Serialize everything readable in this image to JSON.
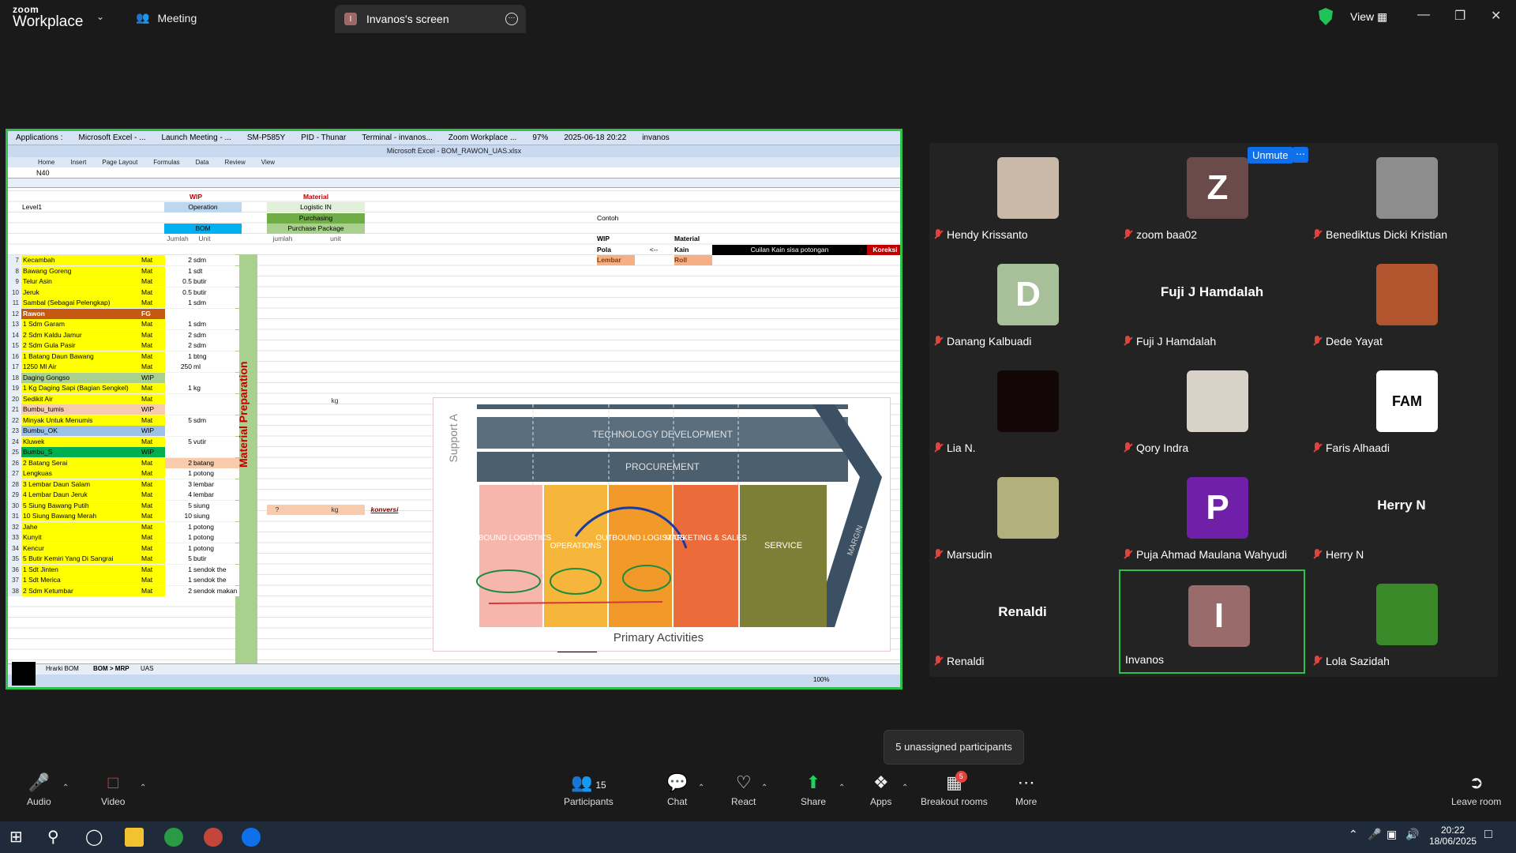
{
  "titlebar": {
    "logo_top": "zoom",
    "logo_bottom": "Workplace",
    "meeting_label": "Meeting",
    "tab_initial": "I",
    "tab_title": "Invanos's screen",
    "view_label": "View"
  },
  "shared_screen": {
    "taskbar_items": [
      "Applications :",
      "Microsoft Excel - ...",
      "Launch Meeting - ...",
      "SM-P585Y",
      "PID - Thunar",
      "Terminal - invanos...",
      "Zoom Workplace ...",
      "97%",
      "2025-06-18 20:22",
      "invanos"
    ],
    "excel_title": "Microsoft Excel - BOM_RAWON_UAS.xlsx",
    "ribbon_tabs": [
      "Home",
      "Insert",
      "Page Layout",
      "Formulas",
      "Data",
      "Review",
      "View"
    ],
    "name_box": "N40",
    "headers": {
      "wip": "WIP",
      "material": "Material",
      "level1": "Level1",
      "operation": "Operation",
      "logistic_in": "Logistic IN",
      "purchasing": "Purchasing",
      "bom": "BOM",
      "purchase_package": "Purchase Package",
      "jumlah": "Jumlah",
      "unit": "Unit",
      "jumlah2": "jumlah",
      "unit2": "unit",
      "contoh": "Contoh",
      "wip2": "WIP",
      "material2": "Material",
      "pola": "Pola",
      "arrow": "<--",
      "kain": "Kain",
      "cuilan": "Cuilan Kain sisa potongan",
      "koreksi": "Koreksi",
      "lembar": "Lembar",
      "roll": "Roll",
      "material_prep": "Material Preparation"
    },
    "rows": [
      {
        "n": "7",
        "b": "Kecambah",
        "c": "Mat",
        "d": "2",
        "e": "sdm"
      },
      {
        "n": "8",
        "b": "Bawang Goreng",
        "c": "Mat",
        "d": "1",
        "e": "sdt"
      },
      {
        "n": "9",
        "b": "Telur Asin",
        "c": "Mat",
        "d": "0.5",
        "e": "butir"
      },
      {
        "n": "10",
        "b": "Jeruk",
        "c": "Mat",
        "d": "0.5",
        "e": "butir"
      },
      {
        "n": "11",
        "b": "Sambal (Sebagai Pelengkap)",
        "c": "Mat",
        "d": "1",
        "e": "sdm"
      },
      {
        "n": "12",
        "b": "Rawon",
        "c": "FG",
        "d": "",
        "e": ""
      },
      {
        "n": "13",
        "b": "1 Sdm Garam",
        "c": "Mat",
        "d": "1",
        "e": "sdm"
      },
      {
        "n": "14",
        "b": "2 Sdm Kaldu Jamur",
        "c": "Mat",
        "d": "2",
        "e": "sdm"
      },
      {
        "n": "15",
        "b": "2 Sdm Gula Pasir",
        "c": "Mat",
        "d": "2",
        "e": "sdm"
      },
      {
        "n": "16",
        "b": "1 Batang Daun Bawang",
        "c": "Mat",
        "d": "1",
        "e": "btng"
      },
      {
        "n": "17",
        "b": "1250 Ml Air",
        "c": "Mat",
        "d": "250",
        "e": "ml"
      },
      {
        "n": "18",
        "b": "Daging Gongso",
        "c": "WIP",
        "d": "",
        "e": ""
      },
      {
        "n": "19",
        "b": "1 Kg Daging Sapi (Bagian Sengkel)",
        "c": "Mat",
        "d": "1",
        "e": "kg"
      },
      {
        "n": "20",
        "b": "Sedikit Air",
        "c": "Mat",
        "d": "",
        "e": ""
      },
      {
        "n": "21",
        "b": "Bumbu_tumis",
        "c": "WIP",
        "d": "",
        "e": ""
      },
      {
        "n": "22",
        "b": "Minyak Untuk Menumis",
        "c": "Mat",
        "d": "5",
        "e": "sdm"
      },
      {
        "n": "23",
        "b": "Bumbu_OK",
        "c": "WIP",
        "d": "",
        "e": ""
      },
      {
        "n": "24",
        "b": "Kluwek",
        "c": "Mat",
        "d": "5",
        "e": "vutir"
      },
      {
        "n": "25",
        "b": "Bumbu_S",
        "c": "WIP",
        "d": "",
        "e": ""
      },
      {
        "n": "26",
        "b": "2 Batang Serai",
        "c": "Mat",
        "d": "2",
        "e": "batang"
      },
      {
        "n": "27",
        "b": "Lengkuas",
        "c": "Mat",
        "d": "1",
        "e": "potong"
      },
      {
        "n": "28",
        "b": "3 Lembar Daun Salam",
        "c": "Mat",
        "d": "3",
        "e": "lembar"
      },
      {
        "n": "29",
        "b": "4 Lembar Daun Jeruk",
        "c": "Mat",
        "d": "4",
        "e": "lembar"
      },
      {
        "n": "30",
        "b": "5 Siung Bawang Putih",
        "c": "Mat",
        "d": "5",
        "e": "siung"
      },
      {
        "n": "31",
        "b": "10 Siung Bawang Merah",
        "c": "Mat",
        "d": "10",
        "e": "siung"
      },
      {
        "n": "32",
        "b": "Jahe",
        "c": "Mat",
        "d": "1",
        "e": "potong"
      },
      {
        "n": "33",
        "b": "Kunyit",
        "c": "Mat",
        "d": "1",
        "e": "potong"
      },
      {
        "n": "34",
        "b": "Kencur",
        "c": "Mat",
        "d": "1",
        "e": "potong"
      },
      {
        "n": "35",
        "b": "5 Butir Kemiri Yang Di Sangrai",
        "c": "Mat",
        "d": "5",
        "e": "butir"
      },
      {
        "n": "36",
        "b": "1 Sdt Jinten",
        "c": "Mat",
        "d": "1",
        "e": "sendok the"
      },
      {
        "n": "37",
        "b": "1 Sdt Merica",
        "c": "Mat",
        "d": "1",
        "e": "sendok the"
      },
      {
        "n": "38",
        "b": "2 Sdm Ketumbar",
        "c": "Mat",
        "d": "2",
        "e": "sendok makan"
      }
    ],
    "extra_cells": {
      "kg19": "kg",
      "q26": "?",
      "kg26": "kg",
      "konversi": "konversi"
    },
    "value_chain": {
      "support": "Support A",
      "tech": "TECHNOLOGY DEVELOPMENT",
      "proc": "PROCUREMENT",
      "margin": "MARGIN",
      "inbound": "INBOUND LOGISTICS",
      "operations": "OPERATIONS",
      "outbound": "OUTBOUND LOGISTICS",
      "marketing": "MARKETING & SALES",
      "service": "SERVICE",
      "primary": "Primary Activities"
    },
    "sheet_tabs": [
      "Hrarki BOM",
      "BOM > MRP",
      "UAS"
    ],
    "zoom": "100%"
  },
  "participants_panel": {
    "unmute_label": "Unmute",
    "tiles": [
      {
        "name": "Hendy Krissanto",
        "type": "photo",
        "color": "#c9b9a8"
      },
      {
        "name": "zoom baa02",
        "type": "letter",
        "letter": "Z",
        "color": "#6b4a4a"
      },
      {
        "name": "Benediktus Dicki Kristian",
        "type": "photo",
        "color": "#8d8d8d"
      },
      {
        "name": "Danang Kalbuadi",
        "type": "letter",
        "letter": "D",
        "color": "#a8c09a"
      },
      {
        "name": "Fuji J Hamdalah",
        "type": "name",
        "big": "Fuji J Hamdalah"
      },
      {
        "name": "Dede Yayat",
        "type": "photo",
        "color": "#b2552f"
      },
      {
        "name": "Lia N.",
        "type": "photo",
        "color": "#120606"
      },
      {
        "name": "Qory Indra",
        "type": "photo",
        "color": "#d8d2c8"
      },
      {
        "name": "Faris Alhaadi",
        "type": "photo",
        "color": "#ffffff",
        "logo": "FAM"
      },
      {
        "name": "Marsudin",
        "type": "photo",
        "color": "#b2b07d"
      },
      {
        "name": "Puja Ahmad Maulana Wahyudi",
        "type": "letter",
        "letter": "P",
        "color": "#6f1fa8"
      },
      {
        "name": "Herry N",
        "type": "name",
        "big": "Herry N"
      },
      {
        "name": "Renaldi",
        "type": "name",
        "big": "Renaldi"
      },
      {
        "name": "Invanos",
        "type": "letter",
        "letter": "I",
        "color": "#9a6b6b",
        "active": true
      },
      {
        "name": "Lola Sazidah",
        "type": "photo",
        "color": "#3a8a2a"
      }
    ]
  },
  "tooltip": "5 unassigned participants",
  "toolbar": {
    "audio": "Audio",
    "video": "Video",
    "participants": "Participants",
    "participants_count": "15",
    "chat": "Chat",
    "react": "React",
    "share": "Share",
    "apps": "Apps",
    "breakout": "Breakout rooms",
    "breakout_badge": "5",
    "more": "More",
    "leave": "Leave room"
  },
  "windows_taskbar": {
    "time": "20:22",
    "date": "18/06/2025"
  },
  "colors": {
    "zoom_blue": "#0e71eb",
    "active_green": "#2fc24b",
    "mute_red": "#e0443e",
    "yellow": "#ffff00",
    "header_blue": "#00b0f0"
  }
}
